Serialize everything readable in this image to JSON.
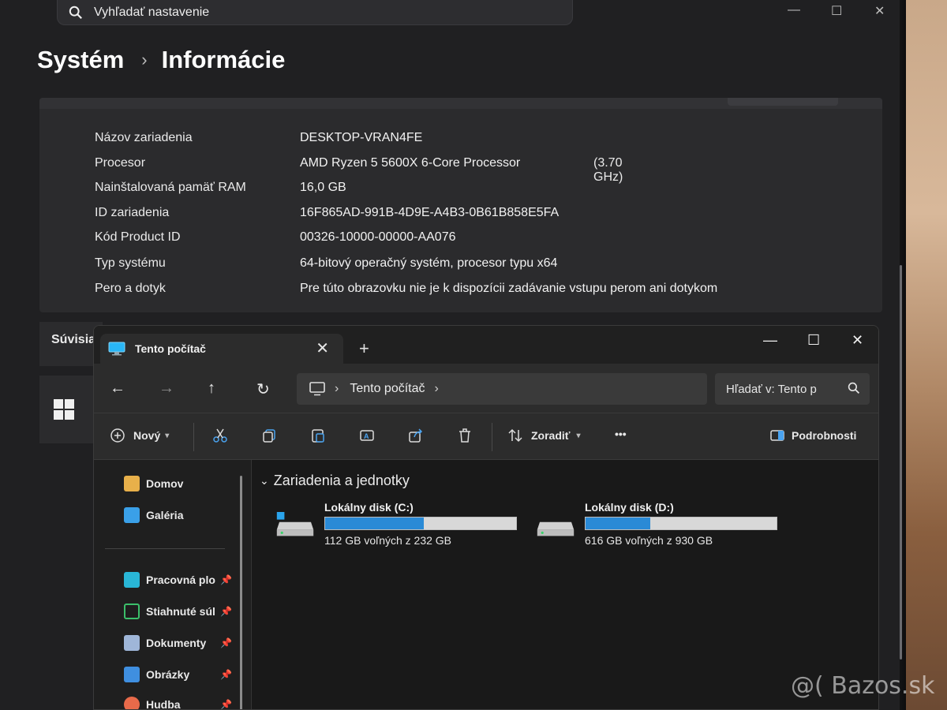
{
  "settings": {
    "search_placeholder": "Vyhľadať nastavenie",
    "window_controls": {
      "minimize": "—",
      "maximize": "☐",
      "close": "✕"
    },
    "breadcrumb": {
      "parent": "Systém",
      "separator": "›",
      "current": "Informácie"
    },
    "specs": [
      {
        "key": "Názov zariadenia",
        "value": "DESKTOP-VRAN4FE"
      },
      {
        "key": "Procesor",
        "value": "AMD Ryzen 5 5600X 6-Core Processor",
        "extra": "(3.70 GHz)"
      },
      {
        "key": "Nainštalovaná pamäť RAM",
        "value": "16,0 GB"
      },
      {
        "key": "ID zariadenia",
        "value": "16F865AD-991B-4D9E-A4B3-0B61B858E5FA"
      },
      {
        "key": "Kód Product ID",
        "value": "00326-10000-00000-AA076"
      },
      {
        "key": "Typ systému",
        "value": "64-bitový operačný systém, procesor typu x64"
      },
      {
        "key": "Pero a dotyk",
        "value": "Pre túto obrazovku nie je k dispozícii zadávanie vstupu perom ani dotykom"
      }
    ],
    "related_label": "Súvisia"
  },
  "explorer": {
    "tab_title": "Tento počítač",
    "tab_close": "✕",
    "new_tab": "+",
    "window_controls": {
      "minimize": "—",
      "maximize": "☐",
      "close": "✕"
    },
    "nav": {
      "back": "←",
      "forward": "→",
      "up": "↑",
      "refresh": "↻"
    },
    "address": {
      "location": "Tento počítač",
      "chevron": "›"
    },
    "search_placeholder": "Hľadať v: Tento p",
    "toolbar": {
      "new_label": "Nový",
      "sort_label": "Zoradiť",
      "more_label": "•••",
      "details_label": "Podrobnosti"
    },
    "navpane": {
      "items": [
        {
          "label": "Domov",
          "icon": "home-icon"
        },
        {
          "label": "Galéria",
          "icon": "gallery-icon"
        }
      ],
      "pinned": [
        {
          "label": "Pracovná plo",
          "icon": "desktop-icon"
        },
        {
          "label": "Stiahnuté súl",
          "icon": "download-icon"
        },
        {
          "label": "Dokumenty",
          "icon": "documents-icon"
        },
        {
          "label": "Obrázky",
          "icon": "pictures-icon"
        },
        {
          "label": "Hudba",
          "icon": "music-icon"
        }
      ]
    },
    "group_title": "Zariadenia a jednotky",
    "drives": [
      {
        "name": "Lokálny disk (C:)",
        "free_text": "112 GB voľných z 232 GB",
        "used_fraction": 0.517,
        "system": true
      },
      {
        "name": "Lokálny disk (D:)",
        "free_text": "616 GB voľných z 930 GB",
        "used_fraction": 0.338,
        "system": false
      }
    ]
  },
  "watermark": "@( Bazos.sk",
  "colors": {
    "accent": "#2a8ad6",
    "bar_bg": "#d8d8d8"
  }
}
